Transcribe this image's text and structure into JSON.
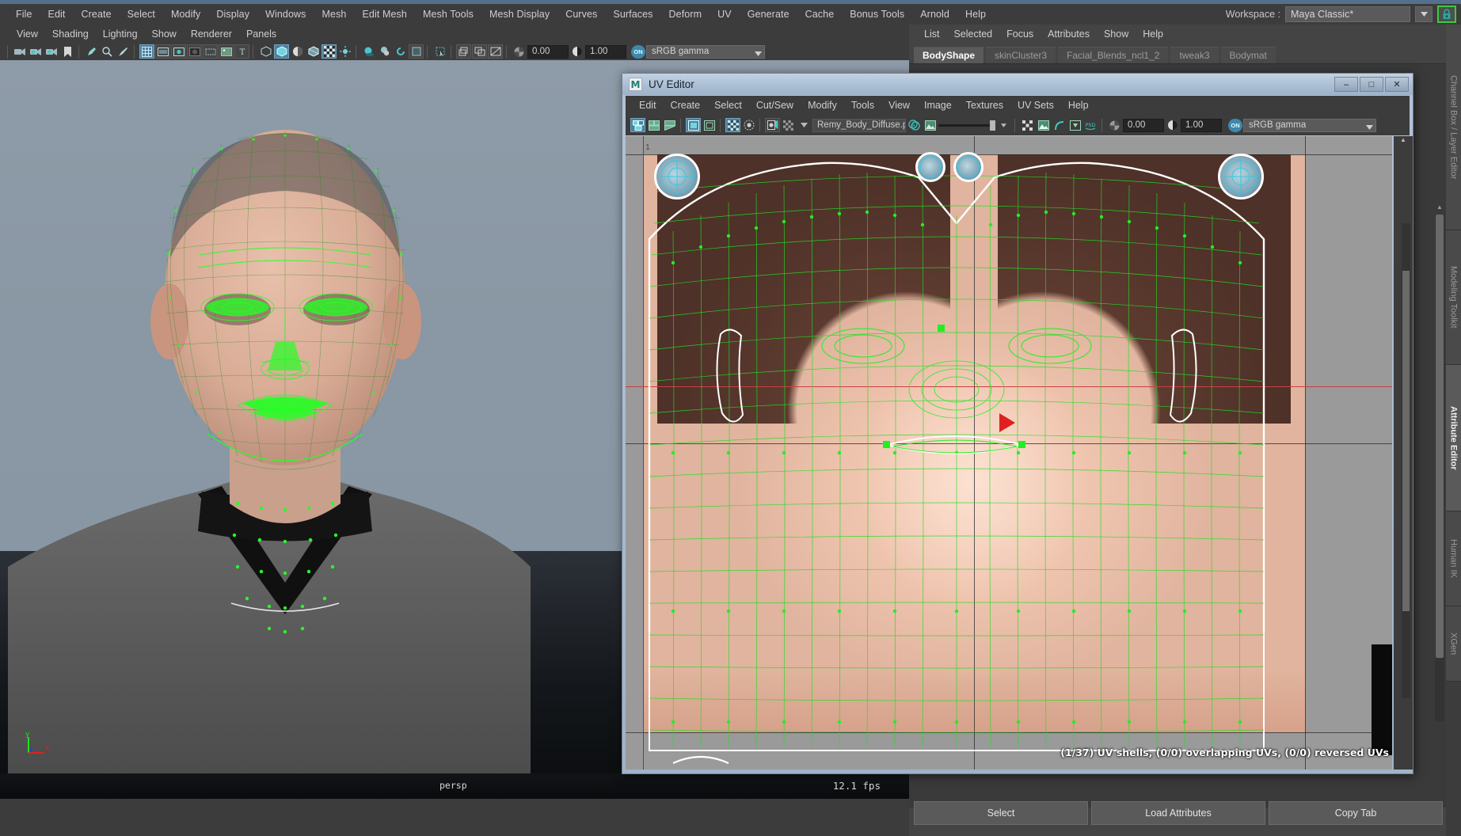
{
  "app": {
    "menus": [
      "File",
      "Edit",
      "Create",
      "Select",
      "Modify",
      "Display",
      "Windows",
      "Mesh",
      "Edit Mesh",
      "Mesh Tools",
      "Mesh Display",
      "Curves",
      "Surfaces",
      "Deform",
      "UV",
      "Generate",
      "Cache",
      "Bonus Tools",
      "Arnold",
      "Help"
    ],
    "workspace_label": "Workspace :",
    "workspace_value": "Maya Classic*",
    "lock_icon": "lock-icon",
    "dropdown_icon": "chevron-down-icon"
  },
  "viewport": {
    "menus": [
      "View",
      "Shading",
      "Lighting",
      "Show",
      "Renderer",
      "Panels"
    ],
    "toolbar": {
      "exposure_value": "0.00",
      "gamma_value": "1.00",
      "colorspace": "sRGB gamma",
      "toggle_on_label": "ON",
      "icons": [
        "camera-icon",
        "camera-lock-icon",
        "camera-attributes-icon",
        "bookmark-icon",
        "grease-pencil-icon",
        "magnify-icon",
        "paint-icon",
        "grid-icon",
        "film-gate-icon",
        "resolution-gate-icon",
        "gate-mask-icon",
        "selection-highlight-icon",
        "texture-icon",
        "text-icon",
        "wireframe-icon",
        "smooth-shade-icon",
        "flat-shade-icon",
        "shaded-wireframe-icon",
        "texture-map-icon",
        "lighting-icon",
        "shadow-icon",
        "ao-icon",
        "motion-blur-icon",
        "xray-icon",
        "xray-joints-icon",
        "isolate-select-icon",
        "nurbs-icon",
        "surface-icon",
        "render-icon"
      ]
    },
    "camera_label": "persp",
    "fps_label": "12.1 fps",
    "axis": {
      "x": "x",
      "y": "y",
      "x_color": "#e02020",
      "y_color": "#20e020",
      "z_color": "#2020e0"
    }
  },
  "uv_editor": {
    "title": "UV Editor",
    "app_icon": "maya-logo-icon",
    "window_buttons": [
      {
        "name": "minimize-button",
        "glyph": "–"
      },
      {
        "name": "maximize-button",
        "glyph": "□"
      },
      {
        "name": "close-button",
        "glyph": "✕"
      }
    ],
    "menus": [
      "Edit",
      "Create",
      "Select",
      "Cut/Sew",
      "Modify",
      "Tools",
      "View",
      "Image",
      "Textures",
      "UV Sets",
      "Help"
    ],
    "toolbar": {
      "texture_name": "Remy_Body_Diffuse.p",
      "exposure_value": "0.00",
      "gamma_value": "1.00",
      "colorspace": "sRGB gamma",
      "toggle_on_label": "ON",
      "icons": [
        "uv-layout-icon",
        "uv-shell-icon",
        "uv-face-icon",
        "uv-border-icon",
        "uv-grid-icon",
        "uv-checker-icon",
        "uv-dim-icon",
        "uv-snapshot-icon",
        "uv-filter-icon",
        "checker-pattern-icon",
        "rgb-channel-icon",
        "alpha-channel-icon",
        "image-dim-slider",
        "uv-distortion-icon",
        "uv-texture-border-icon",
        "uv-smooth-icon",
        "uv-isolate-icon",
        "psd-icon",
        "exposure-icon",
        "gamma-icon"
      ]
    },
    "ruler_tick": "1",
    "status": "(1/37) UV shells, (0/0) overlapping UVs, (0/0) reversed UVs"
  },
  "right_panel": {
    "menus": [
      "List",
      "Selected",
      "Focus",
      "Attributes",
      "Show",
      "Help"
    ],
    "tabs": [
      {
        "label": "BodyShape",
        "active": true
      },
      {
        "label": "skinCluster3",
        "active": false
      },
      {
        "label": "Facial_Blends_ncl1_2",
        "active": false
      },
      {
        "label": "tweak3",
        "active": false
      },
      {
        "label": "Bodymat",
        "active": false
      }
    ],
    "buttons": [
      "Select",
      "Load Attributes",
      "Copy Tab"
    ],
    "vertical_tabs": [
      {
        "label": "Channel Box / Layer Editor",
        "active": false
      },
      {
        "label": "Modeling Toolkit",
        "active": false
      },
      {
        "label": "Attribute Editor",
        "active": true
      },
      {
        "label": "Human IK",
        "active": false
      },
      {
        "label": "XGen",
        "active": false
      }
    ]
  },
  "colors": {
    "chrome": "#3c3c3c",
    "accent_teal": "#4aa0b5",
    "selection_green": "#18ff18",
    "highlight_blue": "#5285a6"
  }
}
